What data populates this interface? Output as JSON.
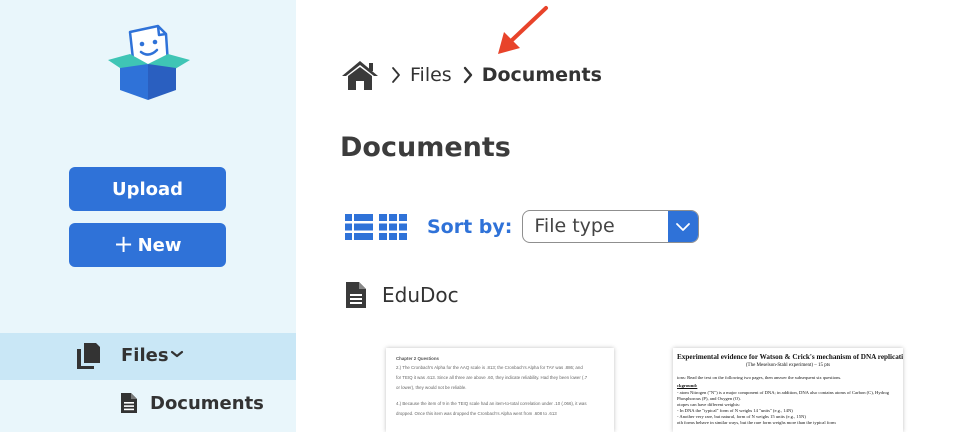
{
  "sidebar": {
    "upload_label": "Upload",
    "new_plus": "+",
    "new_label": "New",
    "files_label": "Files",
    "documents_label": "Documents"
  },
  "breadcrumb": {
    "files": "Files",
    "current": "Documents"
  },
  "main": {
    "title": "Documents",
    "sort_label": "Sort by:",
    "sort_value": "File type",
    "doc_name": "EduDoc"
  },
  "thumbnails": {
    "doc1": {
      "heading": "Chapter 2 Questions",
      "lines": [
        "2.) The Cronbach's Alpha for the AAQ scale is .813; the Cronbach's Alpha for TAY was .886; and",
        "for TEIQ it was .613. Since all three are above .60, they indicate reliability. Had they been lower (.7",
        "or lower), they would not be reliable.",
        "4.) Because the item of 9 in the TEIQ scale had an item-to-total correlation under .10 (.066), it was",
        "dropped. Once this item was dropped the Cronbach's Alpha went from .608 to .613"
      ]
    },
    "doc2": {
      "title": "Experimental evidence for Watson & Crick's mechanism of DNA replication",
      "subtitle": "(The Meselson-Stahl experiment) – 15 pts",
      "lines": [
        "ions: Read the text on the following two pages, then answer the subsequent six questions.",
        "ckground:",
        "- atom Nitrogen (\"N\") is a major component of DNA; in addition, DNA also contains atoms of Carbon (C), Hydrog",
        "Phosphorous (P), and Oxygen (O).",
        "otopes can have different weights:",
        "- In DNA the \"typical\" form of N weighs 14 \"units\" (e.g., 14N)",
        "- Another very rare, but natural, form of N weighs 15 units (e.g., 15N)",
        "oth forms behave in similar ways, but the rare form weighs more than the typical form"
      ]
    }
  },
  "colors": {
    "accent": "#2f72d8",
    "sidebar_bg": "#e9f6fb",
    "sidebar_selected": "#c9e7f6",
    "annotation_arrow": "#e8432a"
  },
  "icons": [
    "logo-box",
    "files-icon",
    "document-icon",
    "home-icon",
    "chevron-right-icon",
    "list-view-icon",
    "grid-view-icon",
    "chevron-down-icon"
  ]
}
